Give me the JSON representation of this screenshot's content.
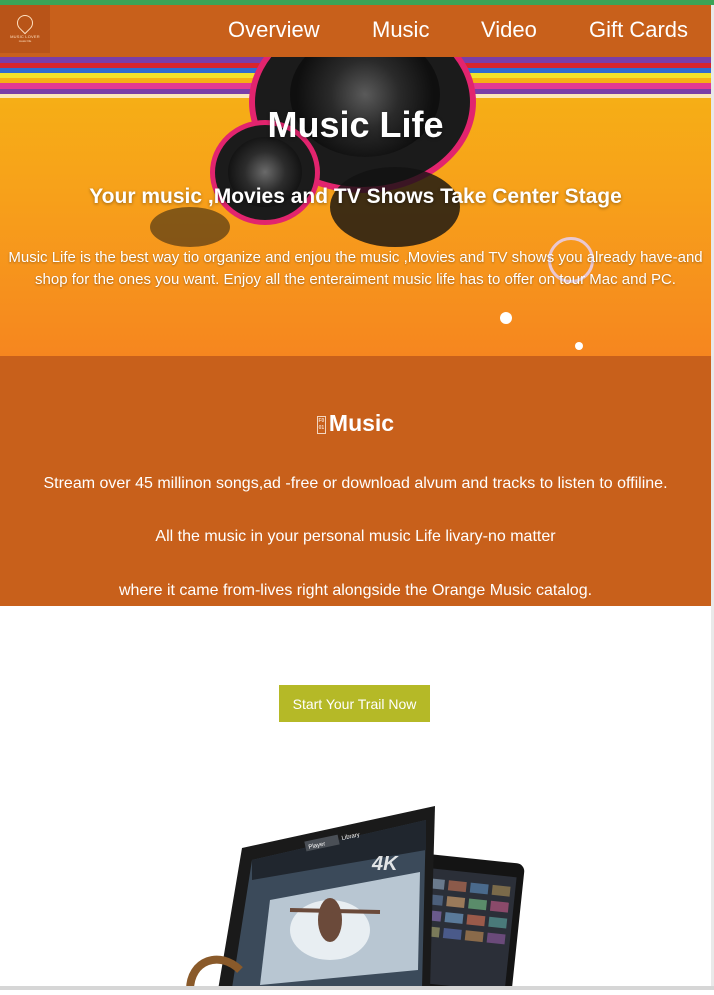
{
  "nav": {
    "logo_text": "MUSIC LOVER",
    "logo_sub": "music life",
    "items": [
      "Overview",
      "Music",
      "Video",
      "Gift Cards"
    ]
  },
  "hero": {
    "title": "Music Life",
    "subtitle": "Your music ,Movies and TV Shows Take Center Stage",
    "text": "Music Life is the best way tio organize and enjou the music ,Movies and TV shows you already have-and shop for the ones you want. Enjoy all the enteraiment music life has to offer on tour Mac and PC."
  },
  "music": {
    "icon_glyph": "F0 01",
    "heading": "Music",
    "line1": "Stream over 45 millinon songs,ad -free or download alvum and tracks to listen to offiline.",
    "line2": "All the music in your personal music Life livary-no matter",
    "line3": "where it came from-lives right alongside the Orange Music catalog."
  },
  "cta": {
    "label": "Start Your Trail Now"
  },
  "devices": {
    "badge": "4K",
    "tab1": "Player",
    "tab2": "Library"
  },
  "colors": {
    "accent": "#c8601b",
    "cta": "#b5b927",
    "topline": "#3aa457"
  }
}
